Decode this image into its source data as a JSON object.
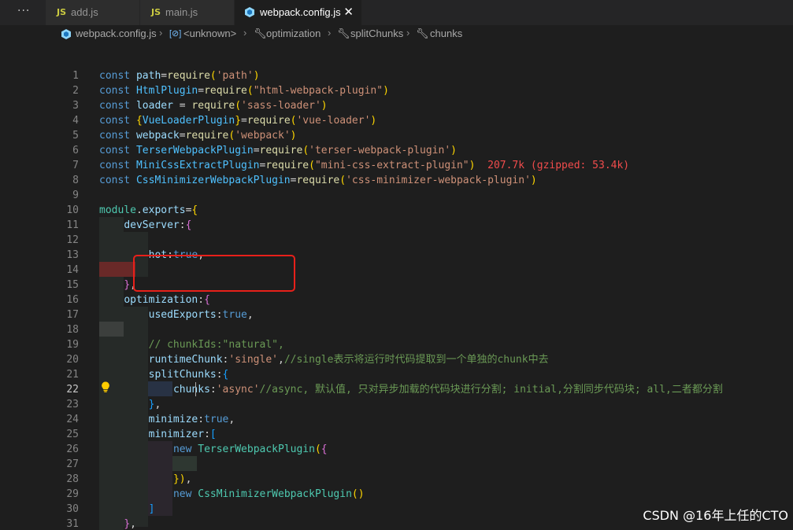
{
  "tabbar": {
    "more": "···",
    "tabs": [
      {
        "icon": "JS",
        "label": "add.js"
      },
      {
        "icon": "JS",
        "label": "main.js"
      },
      {
        "label": "webpack.config.js",
        "close": "✕"
      }
    ]
  },
  "breadcrumb": {
    "file": "webpack.config.js",
    "items": [
      "<unknown>",
      "optimization",
      "splitChunks",
      "chunks"
    ]
  },
  "editor": {
    "current_line": 22,
    "line_numbers": [
      "1",
      "2",
      "3",
      "4",
      "5",
      "6",
      "7",
      "8",
      "9",
      "10",
      "11",
      "12",
      "13",
      "14",
      "15",
      "16",
      "17",
      "18",
      "19",
      "20",
      "21",
      "22",
      "23",
      "24",
      "25",
      "26",
      "27",
      "28",
      "29",
      "30",
      "31"
    ],
    "lines": [
      "const path=require('path')",
      "const HtmlPlugin=require(\"html-webpack-plugin\")",
      "const loader = require('sass-loader')",
      "const {VueLoaderPlugin}=require('vue-loader')",
      "const webpack=require('webpack')",
      "const TerserWebpackPlugin=require('terser-webpack-plugin')",
      "const MiniCssExtractPlugin=require(\"mini-css-extract-plugin\")",
      "const CssMinimizerWebpackPlugin=require('css-minimizer-webpack-plugin')",
      "",
      "module.exports={",
      "    devServer:{",
      "",
      "        hot:true,",
      "",
      "    },",
      "    optimization:{",
      "        usedExports:true,",
      "",
      "        // chunkIds:\"natural\",",
      "        runtimeChunk:'single',//single表示将运行时代码提取到一个单独的chunk中去",
      "        splitChunks:{",
      "            chunks:'async'//async, 默认值, 只对异步加载的代码块进行分割; initial,分割同步代码块; all,二者都分割",
      "        },",
      "        minimize:true,",
      "        minimizer:[",
      "            new TerserWebpackPlugin({",
      "",
      "            }),",
      "            new CssMinimizerWebpackPlugin()",
      "        ]",
      "    },"
    ],
    "import_cost": "207.7k (gzipped: 53.4k)"
  },
  "watermark": "CSDN @16年上任的CTO",
  "colors": {
    "keyword": "#569cd6",
    "variable": "#9cdcfe",
    "constant": "#4fc1ff",
    "function": "#dcdcaa",
    "string": "#ce9178",
    "comment": "#6a9955",
    "highlight_box": "#e8201a"
  }
}
